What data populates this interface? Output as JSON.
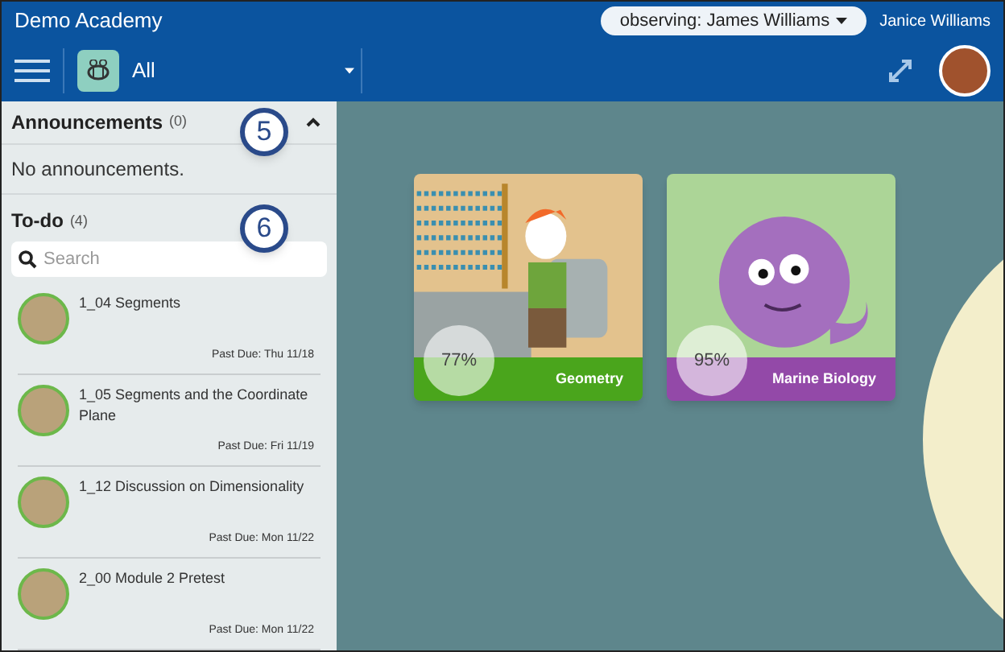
{
  "header": {
    "title": "Demo Academy",
    "observing": "observing: James Williams",
    "user": "Janice Williams"
  },
  "toolbar": {
    "filter": "All"
  },
  "announcements": {
    "title": "Announcements",
    "count": "(0)",
    "expanded": true,
    "empty": "No announcements.",
    "callout": "5"
  },
  "todo": {
    "title": "To-do",
    "count": "(4)",
    "callout": "6",
    "search": {
      "placeholder": "Search"
    },
    "items": [
      {
        "title": "1_04 Segments",
        "due": "Past Due: Thu 11/18"
      },
      {
        "title": "1_05 Segments and the Coordinate Plane",
        "due": "Past Due: Fri 11/19"
      },
      {
        "title": "1_12 Discussion on Dimensionality",
        "due": "Past Due: Mon 11/22"
      },
      {
        "title": "2_00 Module 2 Pretest",
        "due": "Past Due: Mon 11/22"
      }
    ]
  },
  "courses": [
    {
      "name": "Geometry",
      "grade": "77%",
      "color": "#4aa51c",
      "kind": "geometry"
    },
    {
      "name": "Marine Biology",
      "grade": "95%",
      "color": "#9349a8",
      "kind": "octopus"
    }
  ]
}
